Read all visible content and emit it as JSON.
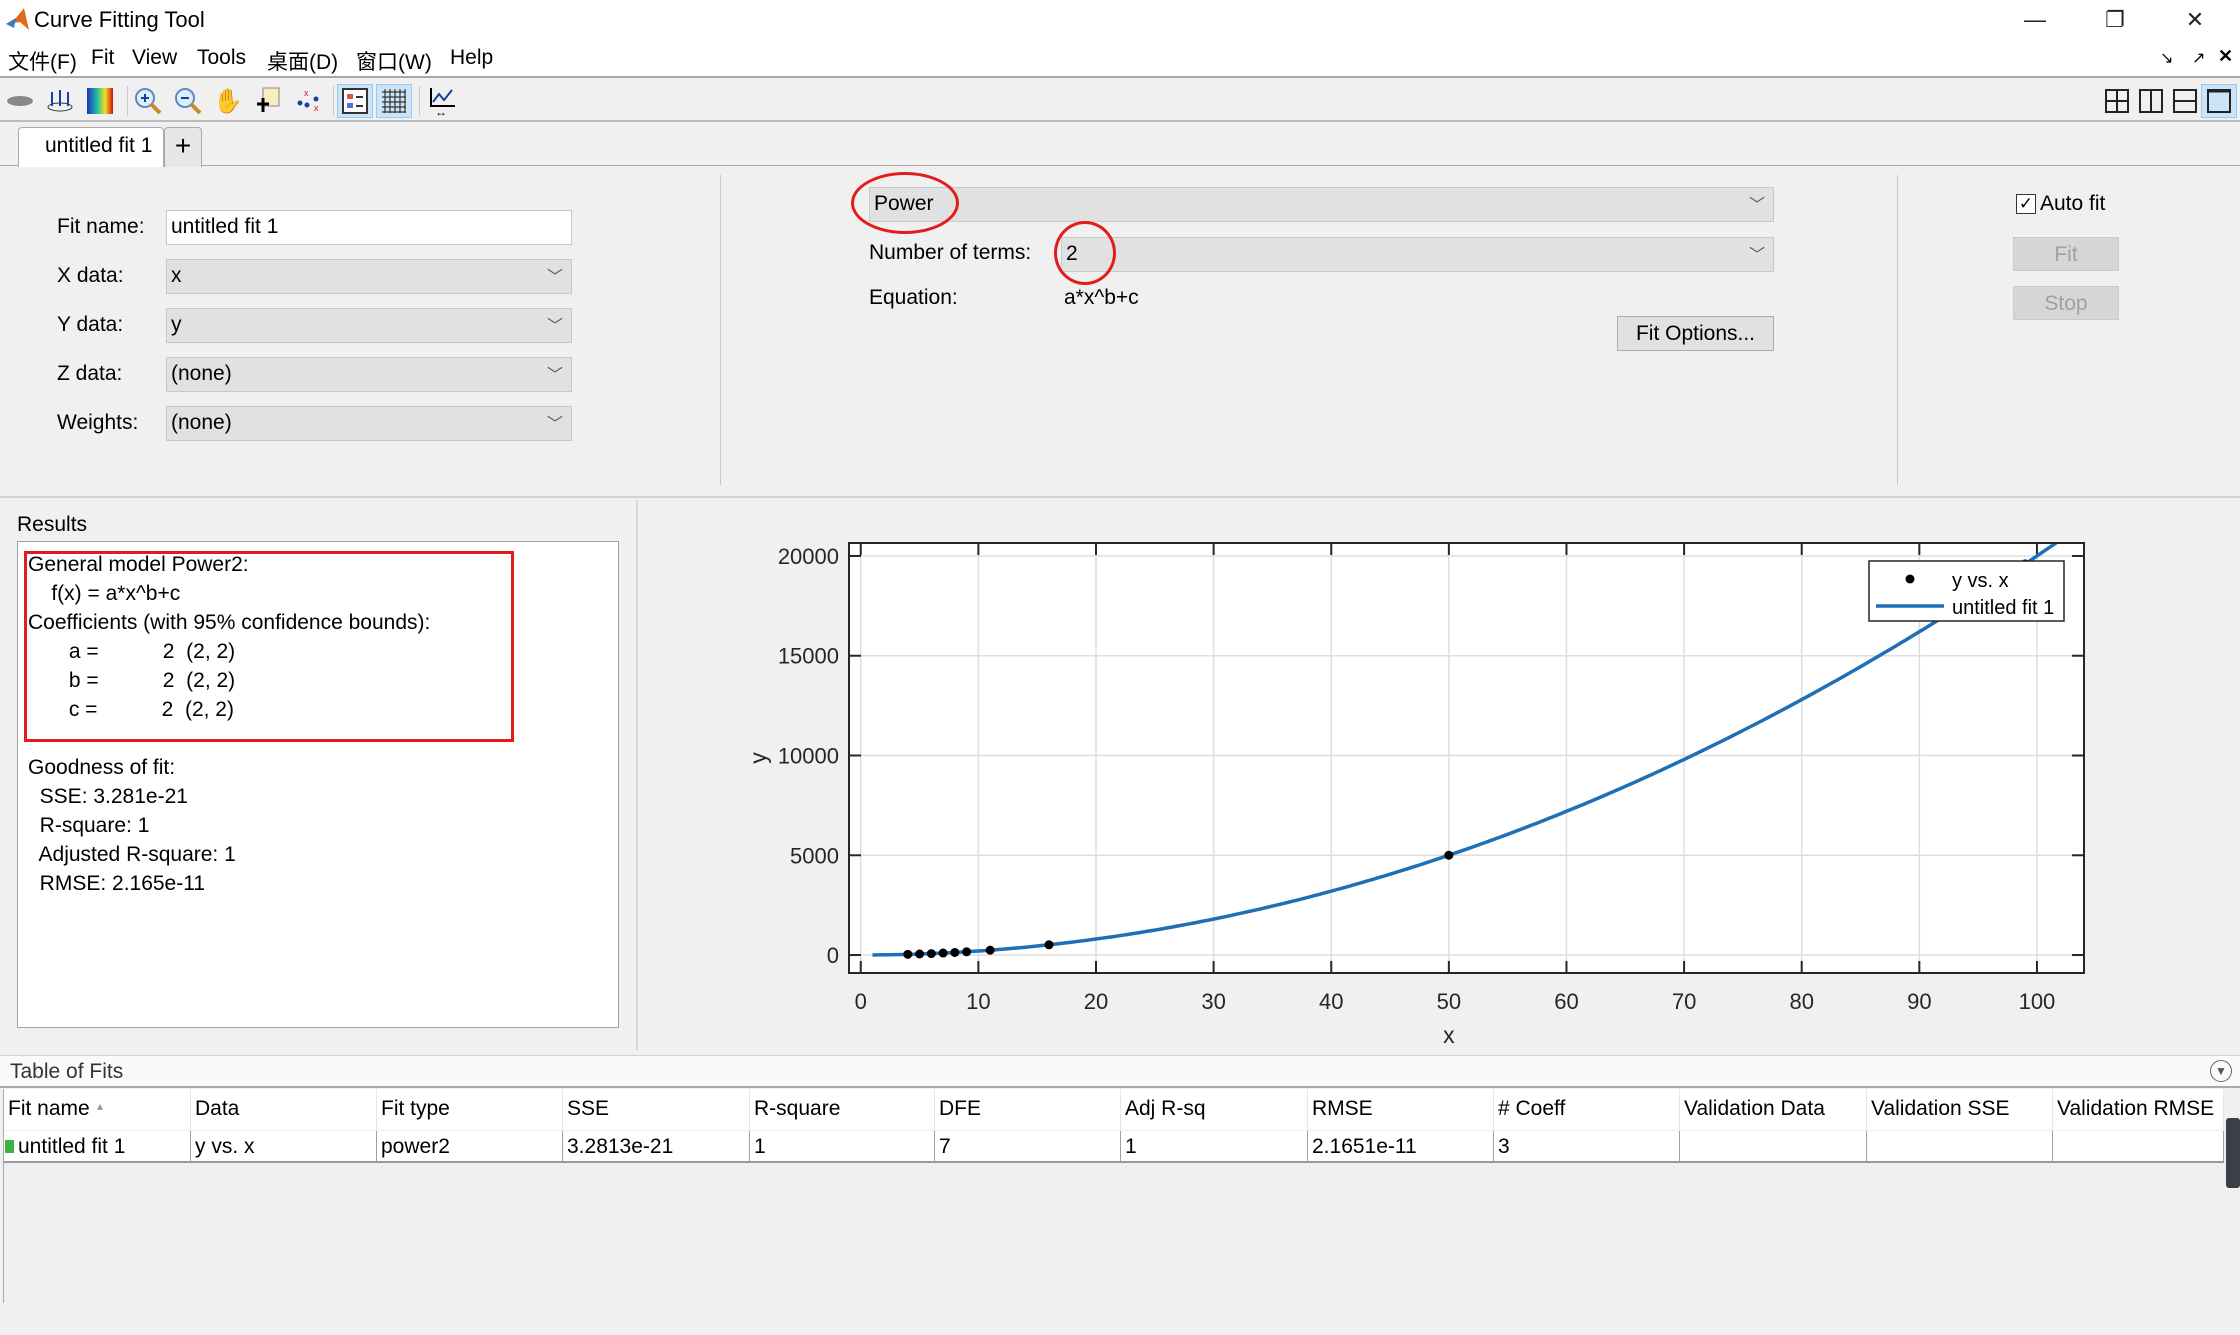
{
  "window": {
    "title": "Curve Fitting Tool",
    "minimize_icon": "minimize-icon",
    "restore_icon": "restore-icon",
    "close_icon": "close-icon"
  },
  "menu": [
    "文件(F)",
    "Fit",
    "View",
    "Tools",
    "桌面(D)",
    "窗口(W)",
    "Help"
  ],
  "tabs": {
    "active": "untitled fit 1",
    "add_label": "+"
  },
  "fit_settings": {
    "fit_name_label": "Fit name:",
    "fit_name_value": "untitled fit 1",
    "x_label": "X data:",
    "x_value": "x",
    "y_label": "Y data:",
    "y_value": "y",
    "z_label": "Z data:",
    "z_value": "(none)",
    "weights_label": "Weights:",
    "weights_value": "(none)",
    "fit_type": "Power",
    "terms_label": "Number of terms:",
    "terms_value": "2",
    "equation_label": "Equation:",
    "equation_value": "a*x^b+c",
    "fit_options": "Fit Options...",
    "auto_fit_label": "Auto fit",
    "auto_fit_checked": true,
    "fit_button": "Fit",
    "stop_button": "Stop",
    "annotation_color": "#e21b1b"
  },
  "results": {
    "title": "Results",
    "lines": [
      "General model Power2:",
      "    f(x) = a*x^b+c",
      "Coefficients (with 95% confidence bounds):",
      "       a =           2  (2, 2)",
      "       b =           2  (2, 2)",
      "       c =           2  (2, 2)",
      "",
      "Goodness of fit:",
      "  SSE: 3.281e-21",
      "  R-square: 1",
      "  Adjusted R-square: 1",
      "  RMSE: 2.165e-11"
    ]
  },
  "chart_data": {
    "type": "scatter",
    "xlabel": "x",
    "ylabel": "y",
    "xlim": [
      -1,
      104
    ],
    "ylim": [
      -900,
      20650
    ],
    "xticks": [
      0,
      10,
      20,
      30,
      40,
      50,
      60,
      70,
      80,
      90,
      100
    ],
    "yticks": [
      0,
      5000,
      10000,
      15000,
      20000
    ],
    "grid": true,
    "legend_position": "top-right",
    "series": [
      {
        "name": "y vs. x",
        "type": "scatter",
        "color": "#000000",
        "x": [
          4,
          5,
          6,
          7,
          8,
          9,
          11,
          16,
          50,
          99
        ],
        "y": [
          34,
          52,
          74,
          100,
          130,
          164,
          244,
          514,
          5002,
          19604
        ]
      },
      {
        "name": "untitled fit 1",
        "type": "line",
        "color": "#1f6fb6",
        "equation": "2*x^2+2",
        "x_range": [
          1,
          104
        ]
      }
    ]
  },
  "table_of_fits": {
    "title": "Table of Fits",
    "columns": [
      "Fit name",
      "Data",
      "Fit type",
      "SSE",
      "R-square",
      "DFE",
      "Adj R-sq",
      "RMSE",
      "# Coeff",
      "Validation Data",
      "Validation SSE",
      "Validation RMSE"
    ],
    "rows": [
      [
        "untitled fit 1",
        "y vs. x",
        "power2",
        "3.2813e-21",
        "1",
        "7",
        "1",
        "2.1651e-11",
        "3",
        "",
        "",
        ""
      ]
    ]
  }
}
